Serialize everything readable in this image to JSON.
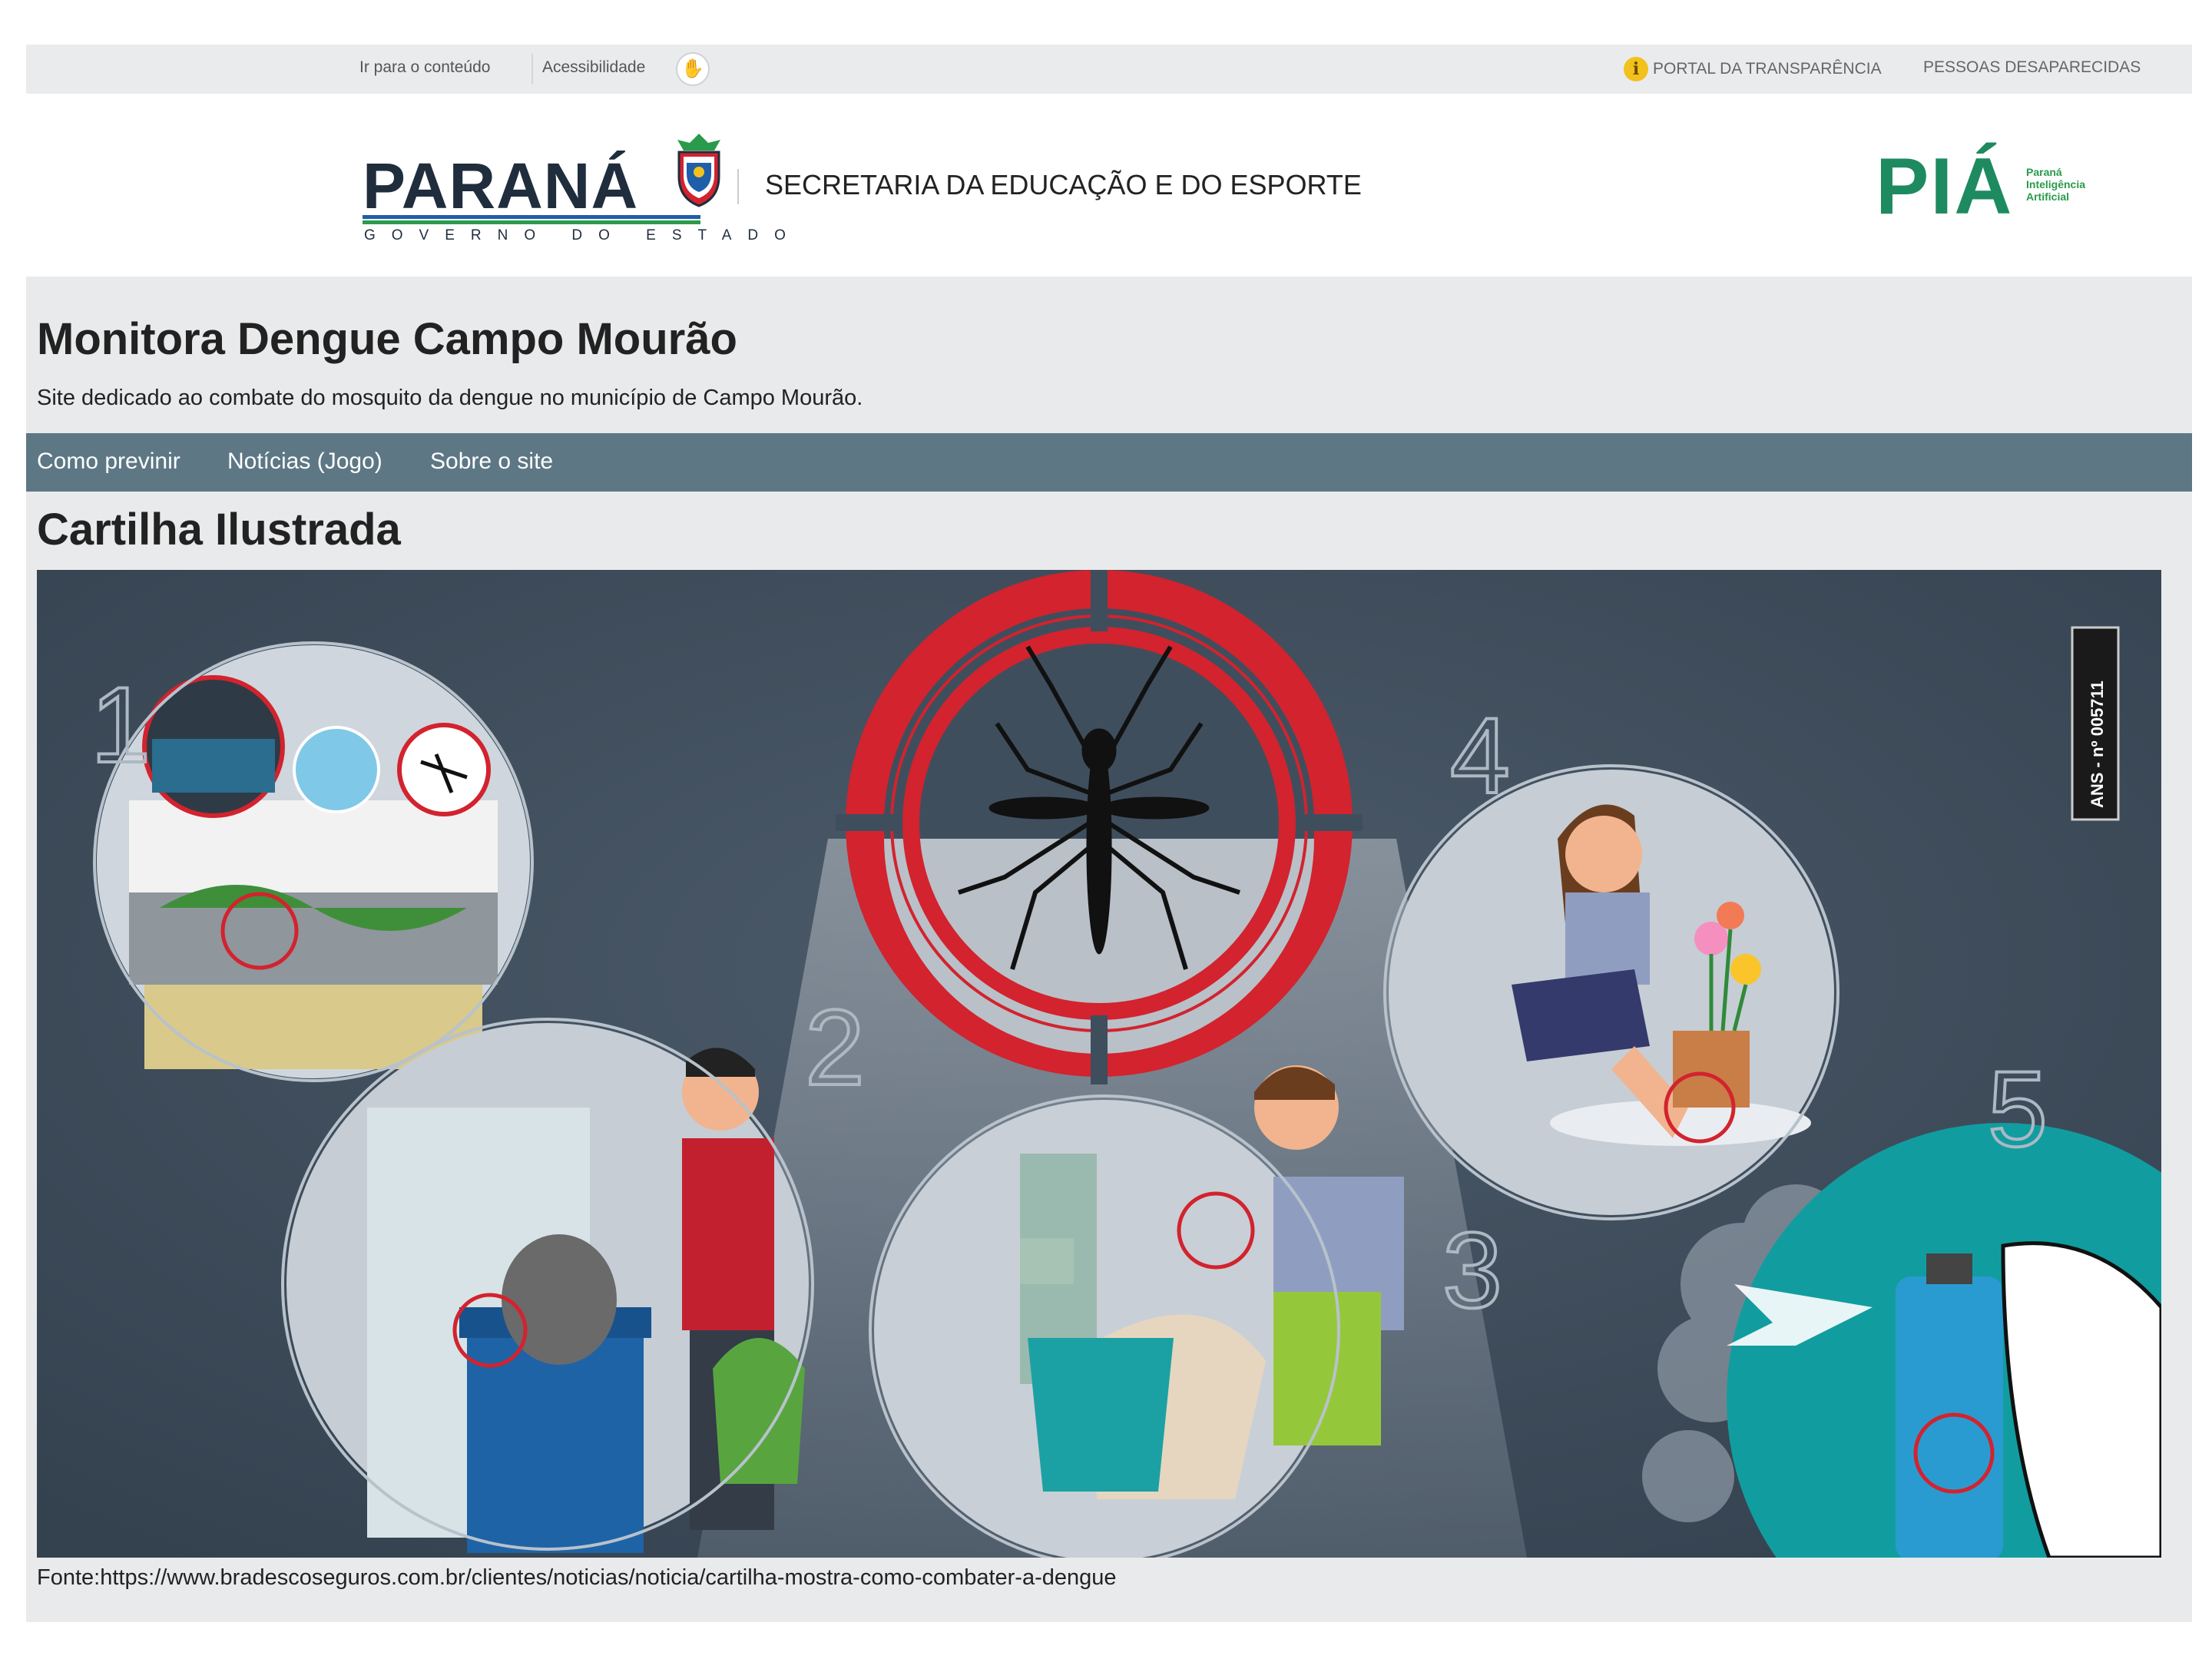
{
  "topbar": {
    "skip_link": "Ir para o conteúdo",
    "accessibility_link": "Acessibilidade",
    "libras_icon": "sign-language-icon",
    "transparency_link": "PORTAL DA TRANSPARÊNCIA",
    "missing_people_link": "PESSOAS DESAPARECIDAS"
  },
  "header": {
    "gov_logo_word": "PARANÁ",
    "gov_logo_sub": "GOVERNO DO ESTADO",
    "secretaria": "SECRETARIA DA EDUCAÇÃO E DO ESPORTE",
    "pia_logo_word": "PIÁ",
    "pia_logo_sub": "Paraná Inteligência Artificial"
  },
  "site": {
    "title": "Monitora Dengue Campo Mourão",
    "description": "Site dedicado ao combate do mosquito da dengue no município de Campo Mourão."
  },
  "nav": {
    "items": [
      {
        "label": "Como previnir"
      },
      {
        "label": "Notícias (Jogo)"
      },
      {
        "label": "Sobre o site"
      }
    ]
  },
  "content": {
    "section_title": "Cartilha Ilustrada",
    "illustration": {
      "step_numbers": [
        "1",
        "2",
        "3",
        "4",
        "5"
      ],
      "ans_label": "ANS - nº 005711"
    },
    "caption": "Fonte:https://www.bradescoseguros.com.br/clientes/noticias/noticia/cartilha-mostra-como-combater-a-dengue"
  },
  "colors": {
    "navbar": "#5d7785",
    "illustration_bg": "#3f4e5d",
    "target_red": "#d2232e",
    "teal": "#119da0"
  }
}
